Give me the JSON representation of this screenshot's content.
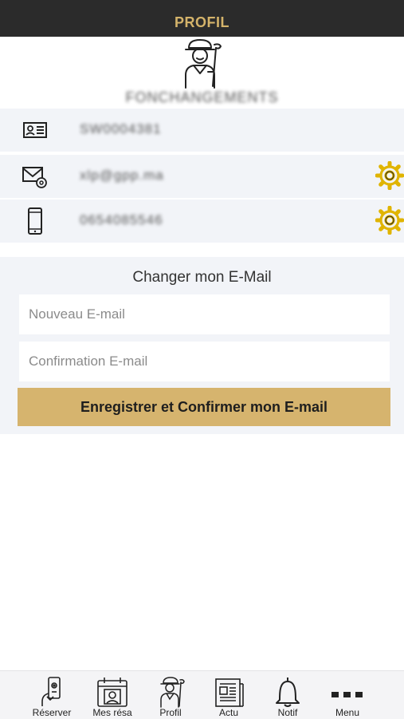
{
  "header": {
    "title": "PROFIL"
  },
  "profile": {
    "name": "FONCHANGEMENTS",
    "id_number": "SW0004381",
    "email": "xlp@gpp.ma",
    "phone": "0654085546"
  },
  "change_email": {
    "title": "Changer mon E-Mail",
    "new_placeholder": "Nouveau E-mail",
    "confirm_placeholder": "Confirmation E-mail",
    "save_label": "Enregistrer et Confirmer mon E-mail"
  },
  "bottom_nav": [
    {
      "label": "Réserver",
      "icon": "phone-booking-icon"
    },
    {
      "label": "Mes résa",
      "icon": "calendar-user-icon"
    },
    {
      "label": "Profil",
      "icon": "golfer-icon"
    },
    {
      "label": "Actu",
      "icon": "newspaper-icon"
    },
    {
      "label": "Notif",
      "icon": "bell-icon"
    },
    {
      "label": "Menu",
      "icon": "more-dots-icon"
    }
  ],
  "colors": {
    "header_bg": "#2b2b2b",
    "accent": "#d4b36a",
    "gear": "#e0b400",
    "section_bg": "#f2f4f8"
  }
}
